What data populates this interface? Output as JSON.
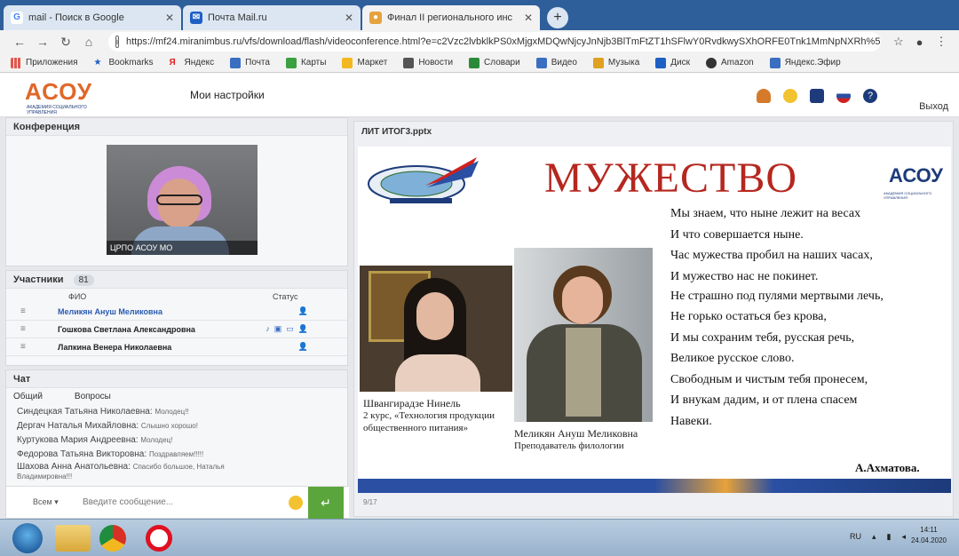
{
  "browser": {
    "tabs": [
      {
        "title": "mail - Поиск в Google",
        "icon": "google-icon",
        "active": false
      },
      {
        "title": "Почта Mail.ru",
        "icon": "mail-icon",
        "active": false
      },
      {
        "title": "Финал II регионального инс",
        "icon": "chrome-page-icon",
        "active": true
      }
    ],
    "new_tab_label": "+",
    "url": "https://mf24.miranimbus.ru/vfs/download/flash/videoconference.html?e=c2Vzc2lvbklkPS0xMjgxMDQwNjcyJnNjb3BlTmFtZT1hSFlwY0RvdkwySXhORFE0Tnk1MmNpNXRh%5...",
    "bookmarks": [
      "Приложения",
      "Bookmarks",
      "Яндекс",
      "Почта",
      "Карты",
      "Маркет",
      "Новости",
      "Словари",
      "Видео",
      "Музыка",
      "Диск",
      "Amazon",
      "Яндекс.Эфир"
    ]
  },
  "app": {
    "logo": "АСОУ",
    "logo_sub": "АКАДЕМИЯ СОЦИАЛЬНОГО УПРАВЛЕНИЯ",
    "settings_label": "Мои настройки",
    "exit_label": "Выход"
  },
  "conference": {
    "title": "Конференция",
    "video_label": "ЦРПО АСОУ МО"
  },
  "participants": {
    "title": "Участники",
    "count": "81",
    "col_name": "ФИО",
    "col_status": "Статус",
    "list": [
      {
        "name": "Меликян  Ануш  Меликовна"
      },
      {
        "name": "Гошкова Светлана Александровна"
      },
      {
        "name": "Лапкина Венера Николаевна"
      }
    ]
  },
  "chat": {
    "title": "Чат",
    "tab_general": "Общий",
    "tab_questions": "Вопросы",
    "messages": [
      {
        "author": "Синдецкая Татьяна Николаевна:",
        "text": "Молодец!!"
      },
      {
        "author": "Дергач Наталья Михайловна:",
        "text": "Слышно хорошо!"
      },
      {
        "author": "Куртукова Мария Андреевна:",
        "text": "Молодец!"
      },
      {
        "author": "Федорова Татьяна Викторовна:",
        "text": "Поздравляем!!!!!"
      },
      {
        "author": "Шахова Анна Анатольевна:",
        "text": "Спасибо большое, Наталья"
      },
      {
        "author": "",
        "text": "Владимировна!!!"
      }
    ],
    "recipient": "Всем",
    "input_placeholder": "Введите сообщение...",
    "send_icon": "enter-arrow-icon"
  },
  "presentation": {
    "file": "ЛИТ ИТОГ3.pptx",
    "page": "9/17",
    "slide": {
      "heading": "МУЖЕСТВО",
      "logo": "АСОУ",
      "logo_sub": "АКАДЕМИЯ СОЦИАЛЬНОГО УПРАВЛЕНИЯ",
      "person1_name": "Швангирадзе Нинель",
      "person1_desc": "2 курс, «Технология продукции общественного питания»",
      "person2_name": "Меликян Ануш Меликовна",
      "person2_desc": "Преподаватель филологии",
      "poem": [
        "Мы знаем, что ныне лежит на весах",
        "И что совершается ныне.",
        "Час мужества пробил на наших часах,",
        "И мужество нас не покинет.",
        "Не страшно под пулями мертвыми лечь,",
        "Не горько остаться без крова,",
        "И мы сохраним тебя, русская речь,",
        "Великое русское слово.",
        "Свободным и чистым тебя пронесем,",
        "И внукам дадим, и от плена спасем",
        "Навеки."
      ],
      "author": "А.Ахматова."
    }
  },
  "taskbar": {
    "lang": "RU",
    "time": "14:11",
    "date": "24.04.2020"
  },
  "colors": {
    "browser_blue": "#2f5f9a",
    "logo_orange": "#e0672a",
    "heading_red": "#b5271f",
    "send_green": "#5aa63c"
  }
}
